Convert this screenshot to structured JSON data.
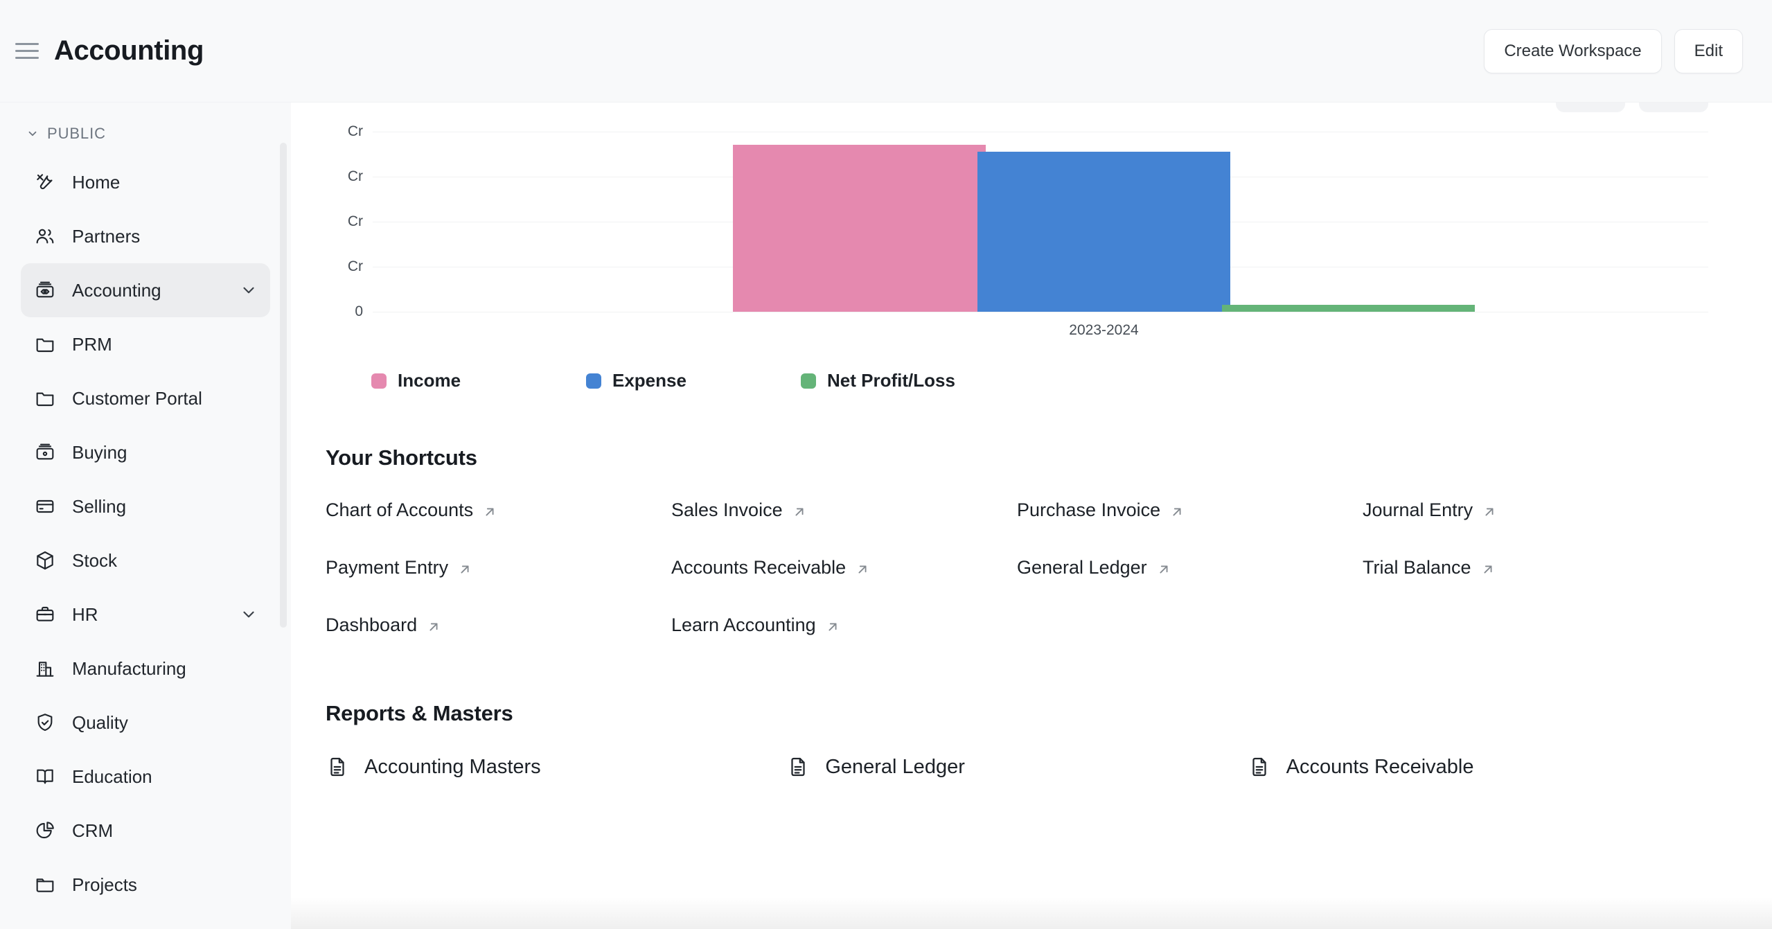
{
  "header": {
    "title": "Accounting",
    "menu_icon": "hamburger-icon",
    "create_workspace_label": "Create Workspace",
    "edit_label": "Edit"
  },
  "sidebar": {
    "section_label": "PUBLIC",
    "items": [
      {
        "label": "Home",
        "icon": "tools-icon",
        "active": false,
        "expandable": false
      },
      {
        "label": "Partners",
        "icon": "users-icon",
        "active": false,
        "expandable": false
      },
      {
        "label": "Accounting",
        "icon": "cash-box-icon",
        "active": true,
        "expandable": true
      },
      {
        "label": "PRM",
        "icon": "folder-icon",
        "active": false,
        "expandable": false
      },
      {
        "label": "Customer Portal",
        "icon": "folder-icon",
        "active": false,
        "expandable": false
      },
      {
        "label": "Buying",
        "icon": "buying-box-icon",
        "active": false,
        "expandable": false
      },
      {
        "label": "Selling",
        "icon": "card-icon",
        "active": false,
        "expandable": false
      },
      {
        "label": "Stock",
        "icon": "package-icon",
        "active": false,
        "expandable": false
      },
      {
        "label": "HR",
        "icon": "briefcase-icon",
        "active": false,
        "expandable": true
      },
      {
        "label": "Manufacturing",
        "icon": "factory-icon",
        "active": false,
        "expandable": false
      },
      {
        "label": "Quality",
        "icon": "shield-check-icon",
        "active": false,
        "expandable": false
      },
      {
        "label": "Education",
        "icon": "book-icon",
        "active": false,
        "expandable": false
      },
      {
        "label": "CRM",
        "icon": "pie-chart-icon",
        "active": false,
        "expandable": false
      },
      {
        "label": "Projects",
        "icon": "folder-open-icon",
        "active": false,
        "expandable": false
      }
    ]
  },
  "chart_data": {
    "type": "bar",
    "title": "",
    "categories": [
      "2023-2024"
    ],
    "xlabel": "",
    "ylabel": "",
    "ytick_labels": [
      "Cr",
      "Cr",
      "Cr",
      "Cr",
      "0"
    ],
    "grid": true,
    "legend_position": "bottom-left",
    "series": [
      {
        "name": "Income",
        "color": "#E589AF",
        "values": [
          4.17
        ]
      },
      {
        "name": "Expense",
        "color": "#4483D3",
        "values": [
          4.0
        ]
      },
      {
        "name": "Net Profit/Loss",
        "color": "#64B478",
        "values": [
          0.17
        ]
      }
    ],
    "ylim": [
      0,
      4.5
    ]
  },
  "shortcuts": {
    "title": "Your Shortcuts",
    "items": [
      {
        "label": "Chart of Accounts"
      },
      {
        "label": "Sales Invoice"
      },
      {
        "label": "Purchase Invoice"
      },
      {
        "label": "Journal Entry"
      },
      {
        "label": "Payment Entry"
      },
      {
        "label": "Accounts Receivable"
      },
      {
        "label": "General Ledger"
      },
      {
        "label": "Trial Balance"
      },
      {
        "label": "Dashboard"
      },
      {
        "label": "Learn Accounting"
      }
    ]
  },
  "reports": {
    "title": "Reports & Masters",
    "items": [
      {
        "label": "Accounting Masters",
        "icon": "document-icon"
      },
      {
        "label": "General Ledger",
        "icon": "document-icon"
      },
      {
        "label": "Accounts Receivable",
        "icon": "document-icon"
      }
    ]
  }
}
